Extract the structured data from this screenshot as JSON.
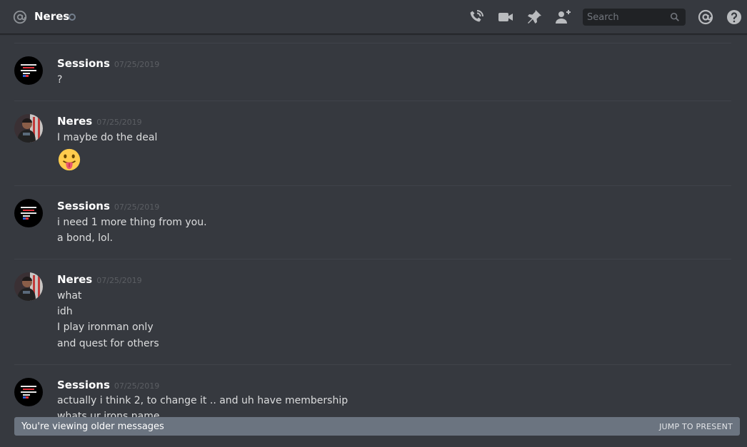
{
  "header": {
    "channel_name": "Neres",
    "status": "offline",
    "search": {
      "placeholder": "Search",
      "value": ""
    },
    "icons": [
      "at-icon",
      "call-icon",
      "video-icon",
      "pin-icon",
      "add-friend-icon",
      "search-icon",
      "mentions-icon",
      "help-icon"
    ]
  },
  "messages": [
    {
      "author": "Sessions",
      "timestamp": "07/25/2019",
      "lines": [
        "?"
      ]
    },
    {
      "author": "Neres",
      "timestamp": "07/25/2019",
      "lines": [
        "I maybe do the deal"
      ],
      "emoji": "stuck-out-tongue"
    },
    {
      "author": "Sessions",
      "timestamp": "07/25/2019",
      "lines": [
        "i need 1 more thing from you.",
        "a bond, lol."
      ]
    },
    {
      "author": "Neres",
      "timestamp": "07/25/2019",
      "lines": [
        "what",
        "idh",
        "I play ironman only",
        "and quest for others"
      ]
    },
    {
      "author": "Sessions",
      "timestamp": "07/25/2019",
      "lines": [
        "actually i think 2, to change it .. and uh have membership",
        "whats ur irons name"
      ]
    }
  ],
  "avatar_text": {
    "sessions": [
      "I MAY NOT BE",
      "ON FIRE",
      "BUT AT LEAST",
      "I'M HOT"
    ]
  },
  "banner": {
    "text": "You're viewing older messages",
    "action": "JUMP TO PRESENT"
  },
  "colors": {
    "background": "#36393f",
    "banner": "#6b7480",
    "username": "#ffffff",
    "timestamp": "#5b5e63"
  }
}
